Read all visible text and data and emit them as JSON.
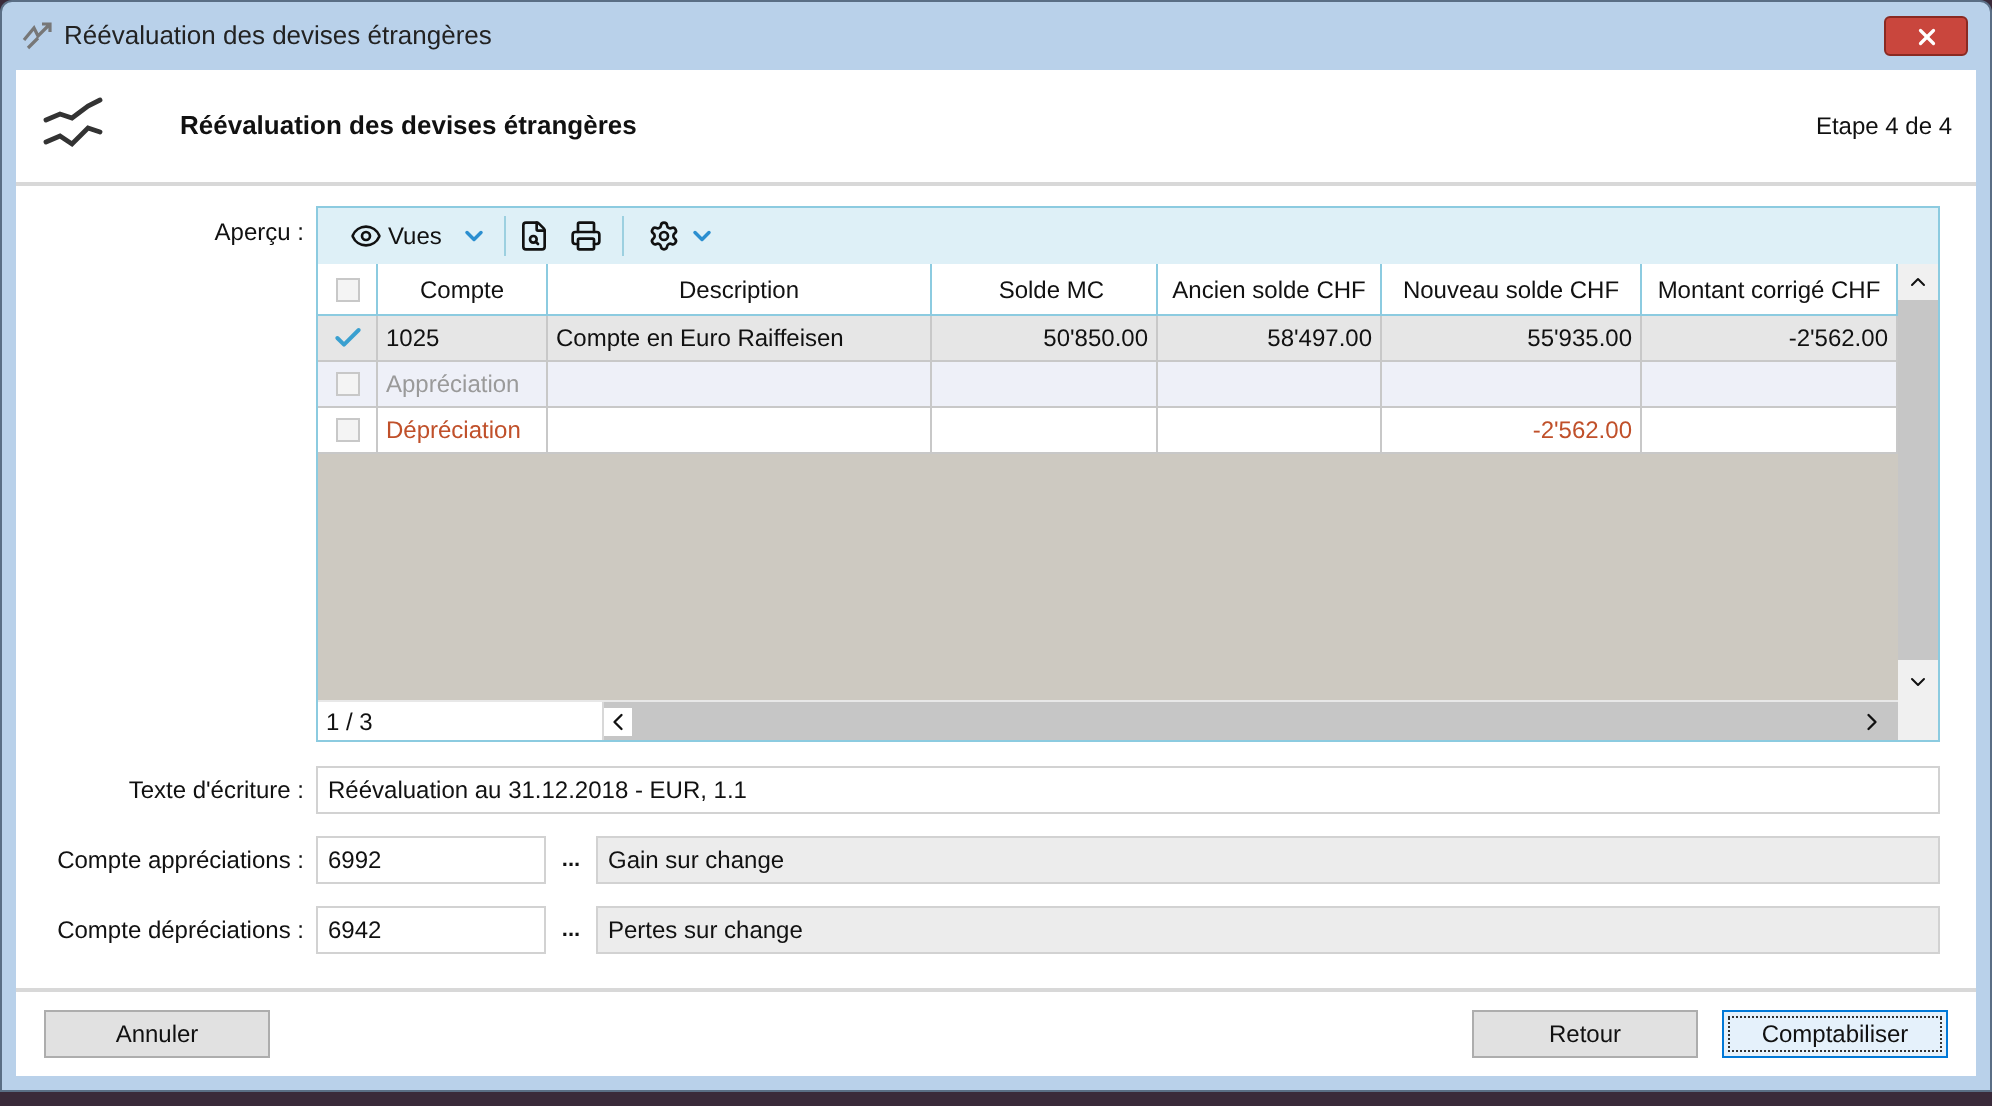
{
  "window": {
    "title": "Réévaluation des devises étrangères"
  },
  "header": {
    "title": "Réévaluation des devises étrangères",
    "step": "Etape 4 de 4"
  },
  "preview": {
    "label": "Aperçu :",
    "toolbar": {
      "views": "Vues"
    },
    "table": {
      "select_all_checked": false,
      "columns": [
        "Compte",
        "Description",
        "Solde MC",
        "Ancien solde CHF",
        "Nouveau solde CHF",
        "Montant corrigé CHF"
      ],
      "rows": [
        {
          "kind": "account",
          "checked": true,
          "selected": true,
          "cells": [
            "1025",
            "Compte en Euro Raiffeisen",
            "50'850.00",
            "58'497.00",
            "55'935.00",
            "-2'562.00"
          ]
        },
        {
          "kind": "gain",
          "checked": false,
          "selected": false,
          "cells": [
            "Appréciation",
            "",
            "",
            "",
            "",
            ""
          ]
        },
        {
          "kind": "loss",
          "checked": false,
          "selected": false,
          "cells": [
            "Dépréciation",
            "",
            "",
            "",
            "-2'562.00",
            ""
          ]
        }
      ]
    },
    "position": "1 / 3"
  },
  "form": [
    {
      "kind": "text",
      "label": "Texte d'écriture :",
      "value": "Réévaluation au 31.12.2018 - EUR, 1.1"
    },
    {
      "kind": "account",
      "label": "Compte appréciations :",
      "value": "6992",
      "lookup": "...",
      "name": "Gain sur change"
    },
    {
      "kind": "account",
      "label": "Compte dépréciations :",
      "value": "6942",
      "lookup": "...",
      "name": "Pertes sur change"
    }
  ],
  "buttons": [
    {
      "label": "Annuler",
      "default": false
    },
    {
      "label": "Retour",
      "default": false
    },
    {
      "label": "Comptabiliser",
      "default": true
    }
  ]
}
